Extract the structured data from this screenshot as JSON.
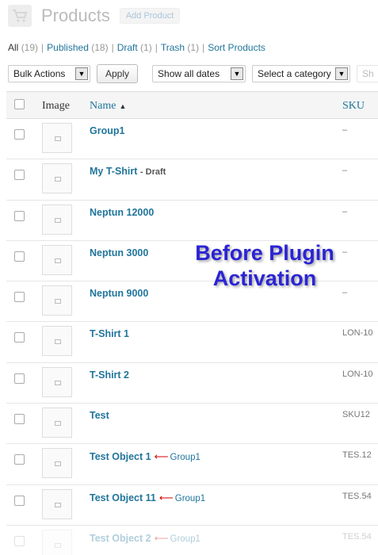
{
  "header": {
    "title": "Products",
    "add_label": "Add Product",
    "icon": "cart-icon"
  },
  "filters": {
    "all": {
      "label": "All",
      "count": "(19)"
    },
    "published": {
      "label": "Published",
      "count": "(18)"
    },
    "draft": {
      "label": "Draft",
      "count": "(1)"
    },
    "trash": {
      "label": "Trash",
      "count": "(1)"
    },
    "sort": {
      "label": "Sort Products"
    }
  },
  "toolbar": {
    "bulk_actions": "Bulk Actions",
    "apply": "Apply",
    "dates": "Show all dates",
    "category": "Select a category",
    "cut": "Sh"
  },
  "columns": {
    "image": "Image",
    "name": "Name",
    "sku": "SKU"
  },
  "rows": [
    {
      "name": "Group1",
      "state": "",
      "parent": "",
      "sku": "–"
    },
    {
      "name": "My T-Shirt",
      "state": "- Draft",
      "parent": "",
      "sku": "–"
    },
    {
      "name": "Neptun 12000",
      "state": "",
      "parent": "",
      "sku": "–"
    },
    {
      "name": "Neptun 3000",
      "state": "",
      "parent": "",
      "sku": "–"
    },
    {
      "name": "Neptun 9000",
      "state": "",
      "parent": "",
      "sku": "–"
    },
    {
      "name": "T-Shirt 1",
      "state": "",
      "parent": "",
      "sku": "LON-10"
    },
    {
      "name": "T-Shirt 2",
      "state": "",
      "parent": "",
      "sku": "LON-10"
    },
    {
      "name": "Test",
      "state": "",
      "parent": "",
      "sku": "SKU12"
    },
    {
      "name": "Test Object 1",
      "state": "",
      "parent": "Group1",
      "sku": "TES.12"
    },
    {
      "name": "Test Object 11",
      "state": "",
      "parent": "Group1",
      "sku": "TES.54"
    },
    {
      "name": "Test Object 2",
      "state": "",
      "parent": "Group1",
      "sku": "TES.54"
    }
  ],
  "overlay": {
    "line1": "Before Plugin",
    "line2": "Activation"
  },
  "colors": {
    "link": "#21759b",
    "overlay": "#2b24d4"
  }
}
